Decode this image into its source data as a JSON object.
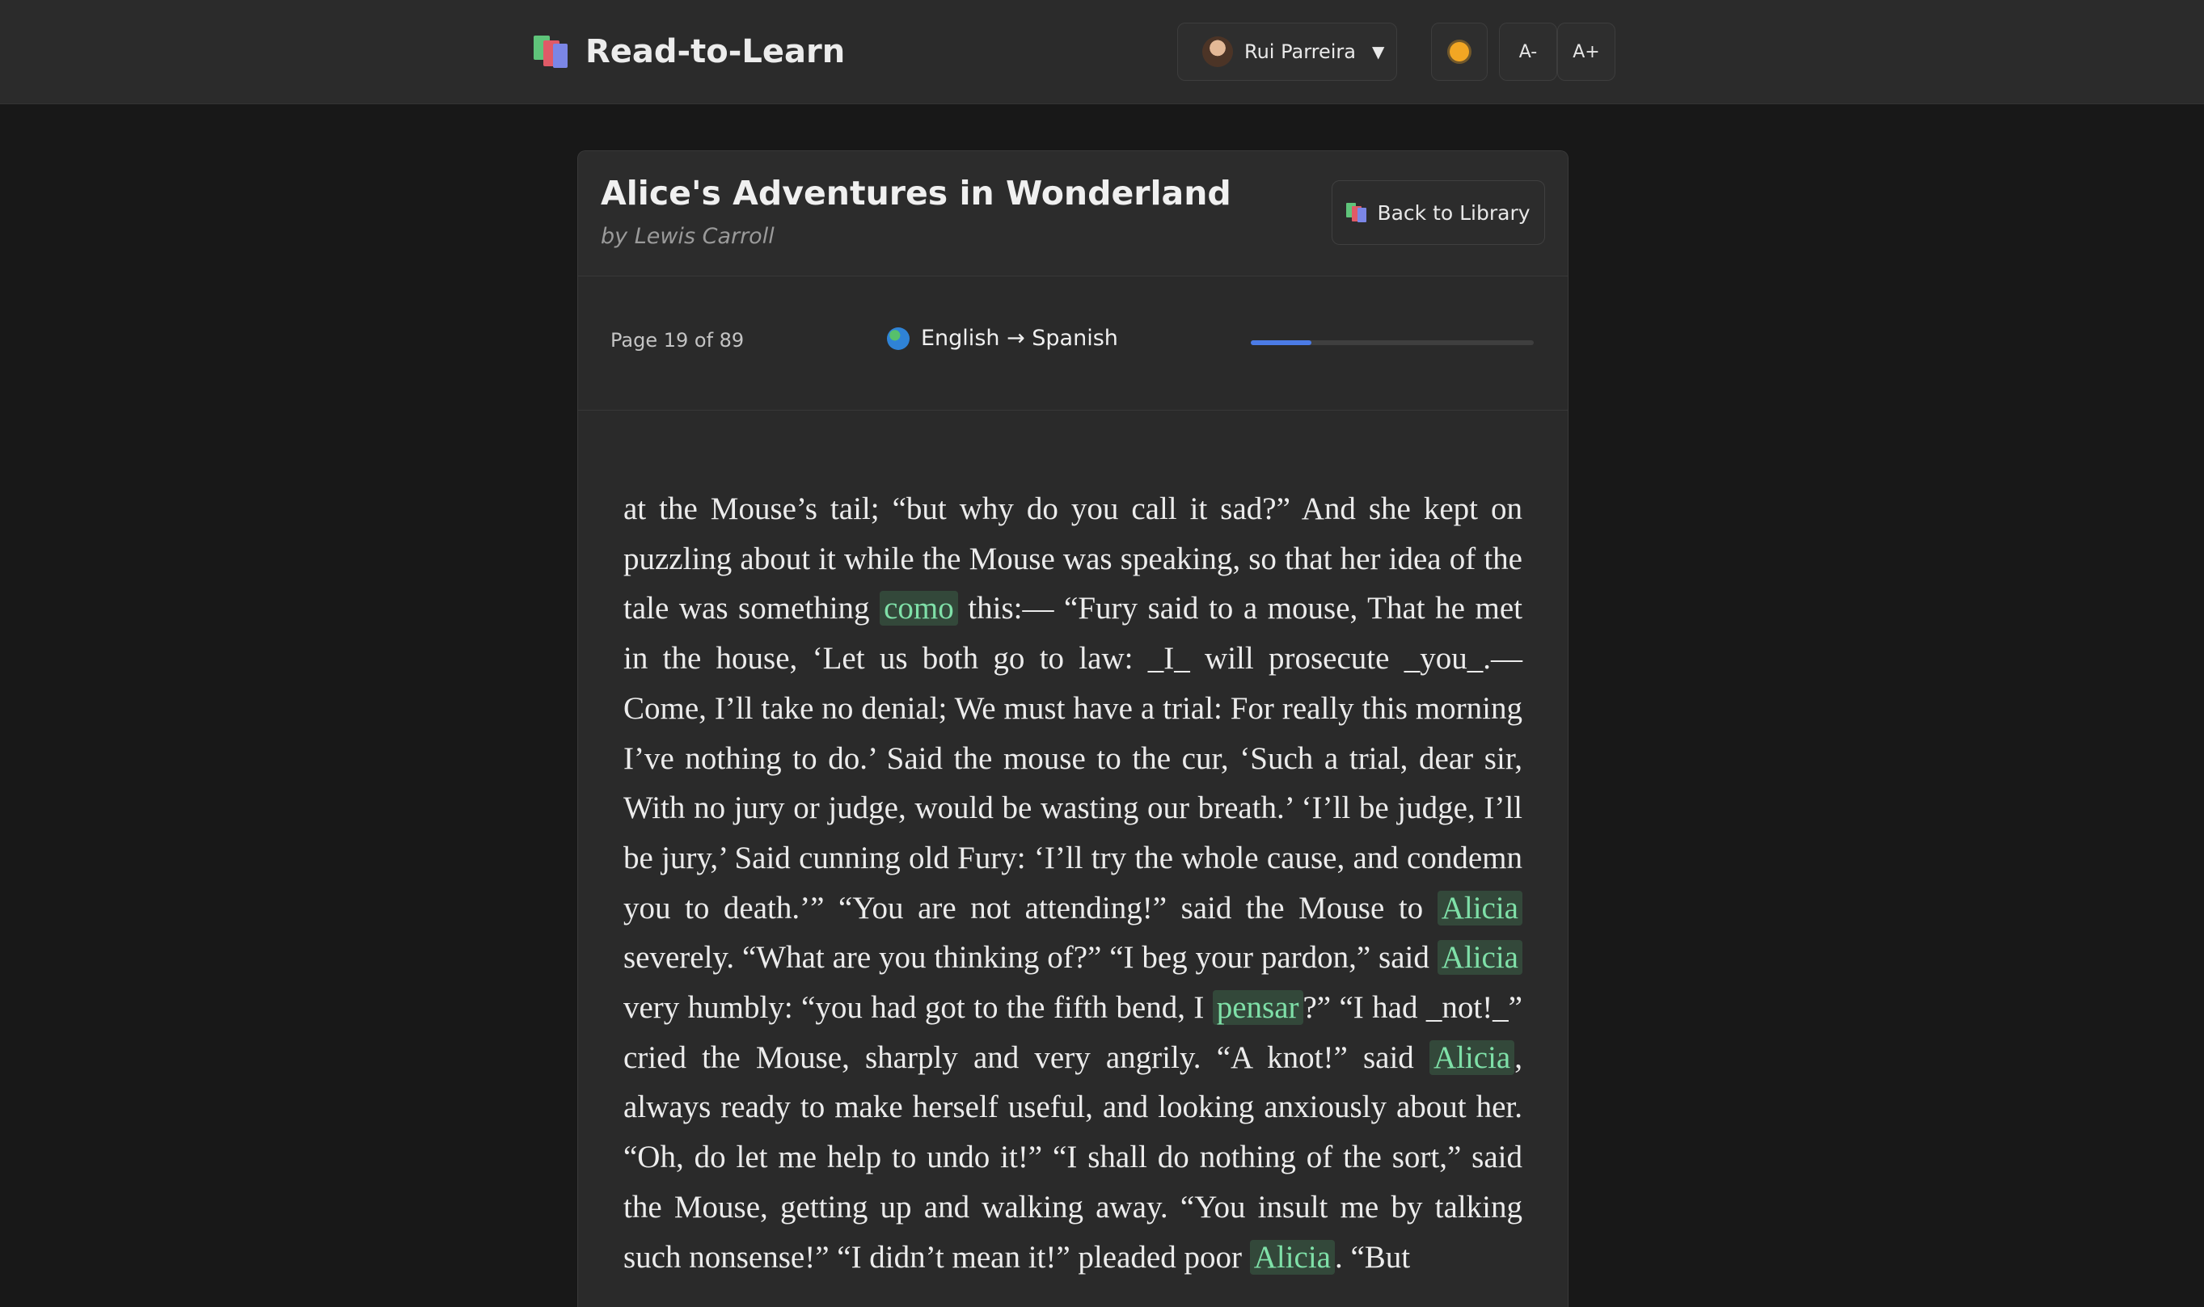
{
  "app": {
    "title": "Read-to-Learn"
  },
  "header": {
    "user": {
      "name": "Rui Parreira"
    },
    "font_decrease": "A-",
    "font_increase": "A+"
  },
  "book": {
    "title": "Alice's Adventures in Wonderland",
    "author": "by Lewis Carroll",
    "back_label": "Back to Library"
  },
  "reader": {
    "page_indicator": "Page 19 of 89",
    "languages": "English → Spanish",
    "progress_fraction": 0.2135,
    "passage": [
      {
        "t": "at the Mouse’s tail; “but why do you call it sad?” And she kept on puzzling about it while the Mouse was speaking, so that her idea of the tale was something "
      },
      {
        "w": "como"
      },
      {
        "t": " this:— “Fury said to a mouse, That he met in the house, ‘Let us both go to law: _I_ will prose­cute _you_.—Come, I’ll take no denial; We must have a trial: For really this morning I’ve nothing to do.’ Said the mouse to the cur, ‘Such a trial, dear sir, With no jury or judge, would be wasting our breath.’ ‘I’ll be judge, I’ll be jury,’ Said cunning old Fury: ‘I’ll try the whole cause, and condemn you to death.’” “You are not at­tending!” said the Mouse to "
      },
      {
        "w": "Alicia"
      },
      {
        "t": " severely. “What are you think­ing of?” “I beg your pardon,” said "
      },
      {
        "w": "Alicia"
      },
      {
        "t": " very humbly: “you had got to the fifth bend, I "
      },
      {
        "w": "pensar"
      },
      {
        "t": "?” “I had _not!_” cried the Mouse, sharply and very angrily. “A knot!” said "
      },
      {
        "w": "Alicia"
      },
      {
        "t": ", always ready to make herself useful, and looking anxiously about her. “Oh, do let me help to undo it!” “I shall do nothing of the sort,” said the Mouse, getting up and walking away. “You insult me by talking such nonsense!” “I didn’t mean it!” pleaded poor "
      },
      {
        "w": "Alicia"
      },
      {
        "t": ". “But"
      }
    ]
  },
  "colors": {
    "accent": "#4b7be6",
    "highlight_text": "#7fe0a8",
    "background": "#181818",
    "topbar": "#2b2b2b",
    "card": "#2a2a2a"
  },
  "icons": {
    "brand": "books-icon",
    "theme": "sun-icon",
    "language": "globe-icon",
    "user_menu": "caret-down-icon"
  }
}
